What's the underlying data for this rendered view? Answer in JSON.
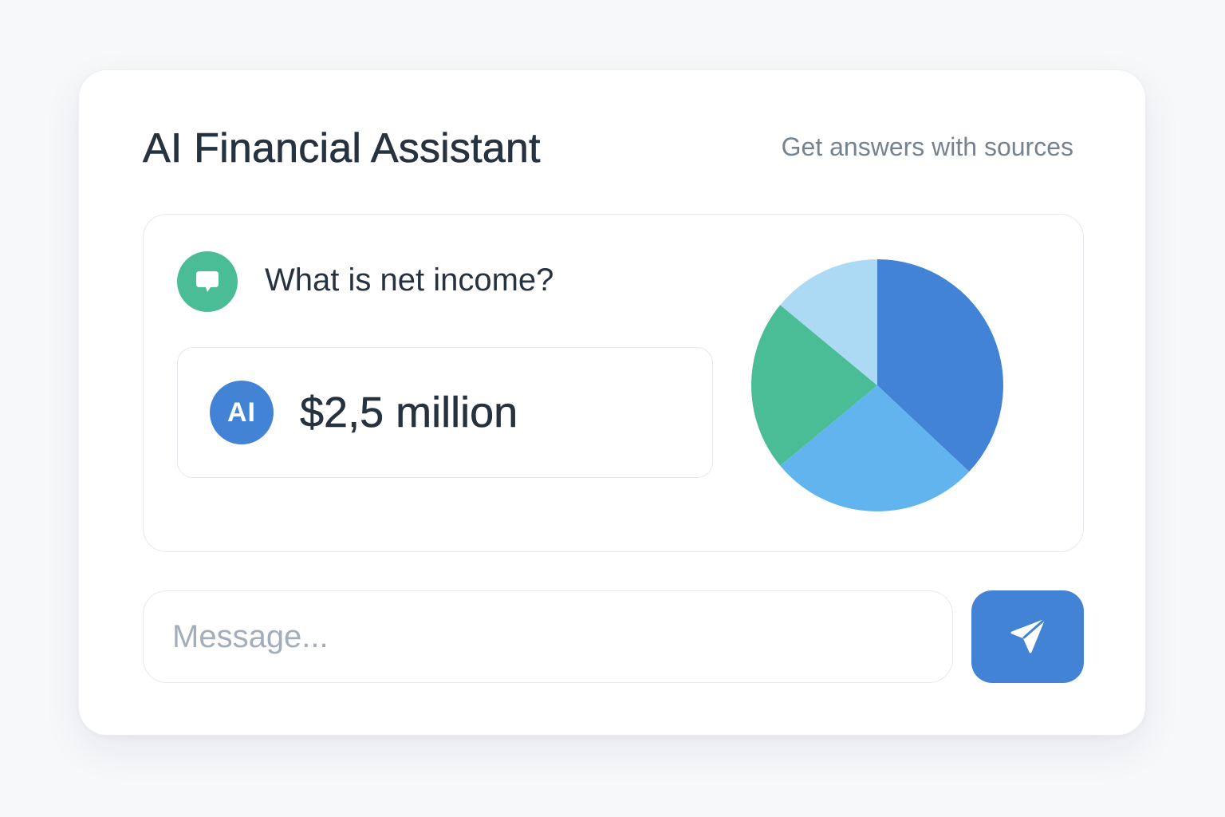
{
  "header": {
    "title": "AI Financial Assistant",
    "subtitle": "Get answers with sources"
  },
  "chat": {
    "question": {
      "icon": "chat-bubble-icon",
      "text": "What is net income?"
    },
    "answer": {
      "avatar_label": "AI",
      "text": "$2,5 million"
    }
  },
  "chart_data": {
    "type": "pie",
    "title": "",
    "slices": [
      {
        "value": 37,
        "color": "#4383d6"
      },
      {
        "value": 27,
        "color": "#62b4ef"
      },
      {
        "value": 22,
        "color": "#4bbd96"
      },
      {
        "value": 14,
        "color": "#acd9f4"
      }
    ]
  },
  "composer": {
    "placeholder": "Message...",
    "send_icon": "send-icon"
  },
  "colors": {
    "accent": "#4383d6",
    "green": "#4bbd96",
    "text": "#27323f",
    "muted": "#76838f"
  }
}
